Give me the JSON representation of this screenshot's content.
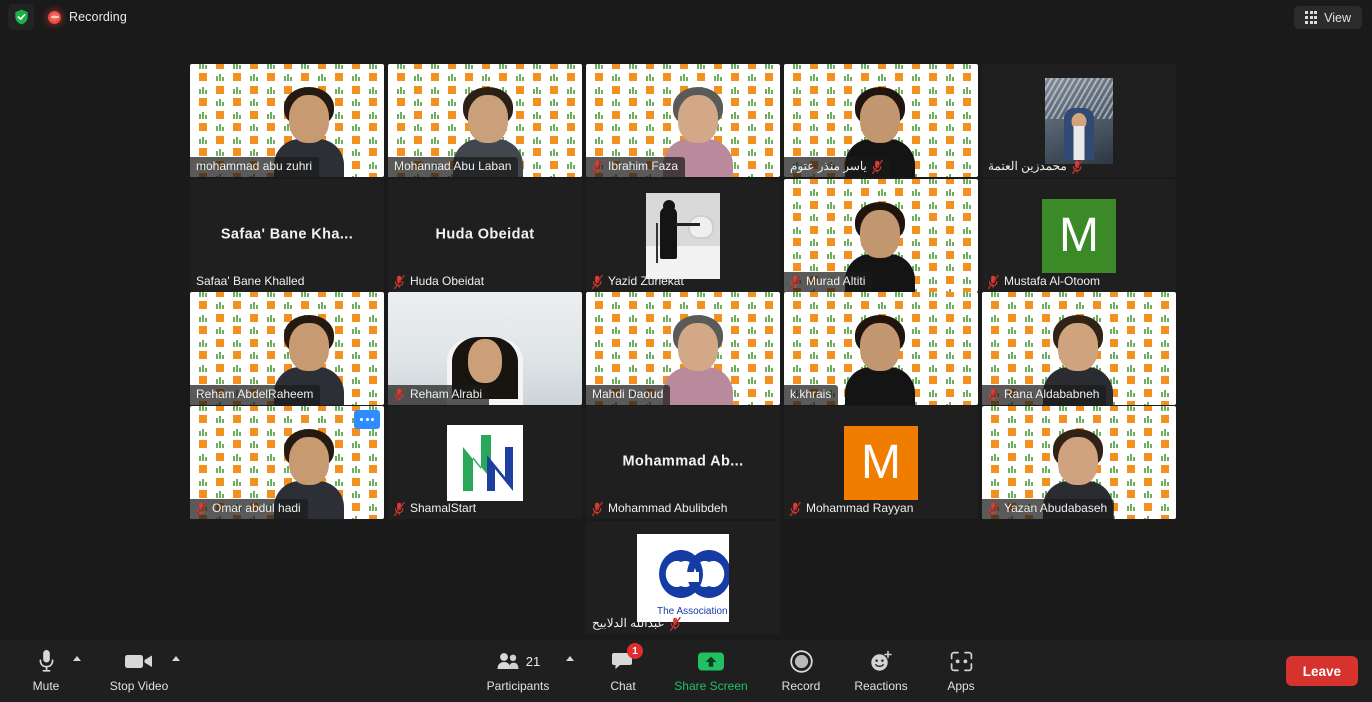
{
  "topbar": {
    "shield_icon": "security-shield-icon",
    "recording_icon": "recording-indicator-icon",
    "recording_label": "Recording",
    "view_icon": "grid-view-icon",
    "view_label": "View"
  },
  "gallery": {
    "active_speaker_color": "#d9ec4e",
    "rows": [
      {
        "tiles": [
          {
            "name": "mohammad abu zuhri",
            "display": "video",
            "muted": false,
            "rtl": false
          },
          {
            "name": "Mohannad Abu Laban",
            "display": "video",
            "muted": false,
            "rtl": false,
            "active": true
          },
          {
            "name": "Ibrahim Faza",
            "display": "video",
            "muted": true,
            "rtl": false
          },
          {
            "name": "ياسر منذر عتوم",
            "display": "video",
            "muted": true,
            "rtl": true
          },
          {
            "name": "محمدزين العتمة",
            "display": "photo",
            "muted": true,
            "rtl": true
          }
        ]
      },
      {
        "tiles": [
          {
            "name": "Safaa' Bane Khalled",
            "big_name": "Safaa' Bane Kha...",
            "display": "name-only",
            "muted": false,
            "rtl": false
          },
          {
            "name": "Huda Obeidat",
            "big_name": "Huda Obeidat",
            "display": "name-only",
            "muted": true,
            "rtl": false
          },
          {
            "name": "Yazid Zuriekat",
            "display": "photo-bw",
            "muted": true,
            "rtl": false
          },
          {
            "name": "Murad Altiti",
            "display": "video",
            "muted": true,
            "rtl": false
          },
          {
            "name": "Mustafa Al-Otoom",
            "display": "letter",
            "letter": "M",
            "letter_color": "#3c8a27",
            "muted": true,
            "rtl": false
          }
        ]
      },
      {
        "tiles": [
          {
            "name": "Reham AbdelRaheem",
            "display": "video",
            "muted": false,
            "rtl": false
          },
          {
            "name": "Reham Alrabi",
            "display": "video-plain",
            "muted": true,
            "rtl": false
          },
          {
            "name": "Mahdi Daoud",
            "display": "video",
            "muted": false,
            "rtl": false
          },
          {
            "name": "k.khrais",
            "display": "video",
            "muted": false,
            "rtl": false
          },
          {
            "name": "Rana Aldababneh",
            "display": "video",
            "muted": true,
            "rtl": false
          }
        ]
      },
      {
        "tiles": [
          {
            "name": "Omar abdul hadi",
            "display": "video",
            "muted": true,
            "rtl": false,
            "more_menu": "more-options-icon"
          },
          {
            "name": "ShamalStart",
            "display": "logo-n",
            "muted": true,
            "rtl": false
          },
          {
            "name": "Mohammad Abulibdeh",
            "big_name": "Mohammad  Ab...",
            "display": "name-only",
            "muted": true,
            "rtl": false
          },
          {
            "name": "Mohammad Rayyan",
            "display": "letter",
            "letter": "M",
            "letter_color": "#f07c00",
            "muted": true,
            "rtl": false
          },
          {
            "name": "Yazan Abudabaseh",
            "display": "video",
            "muted": true,
            "rtl": false
          }
        ]
      },
      {
        "tiles": [
          {
            "name": "عبدالله الدلابيح",
            "display": "logo-assoc",
            "logo_text": "The Association",
            "muted": true,
            "rtl": true
          }
        ]
      }
    ]
  },
  "toolbar": {
    "mute": {
      "label": "Mute",
      "icon": "microphone-icon",
      "chevron": "chevron-up-icon"
    },
    "video": {
      "label": "Stop Video",
      "icon": "camera-icon",
      "chevron": "chevron-up-icon"
    },
    "participants": {
      "label": "Participants",
      "icon": "participants-icon",
      "count": "21",
      "chevron": "chevron-up-icon"
    },
    "chat": {
      "label": "Chat",
      "icon": "chat-bubble-icon",
      "badge": "1"
    },
    "share": {
      "label": "Share Screen",
      "icon": "share-screen-icon",
      "color": "#21c063"
    },
    "record": {
      "label": "Record",
      "icon": "record-circle-icon"
    },
    "reactions": {
      "label": "Reactions",
      "icon": "reactions-smiley-icon"
    },
    "apps": {
      "label": "Apps",
      "icon": "apps-icon"
    },
    "leave": {
      "label": "Leave",
      "color": "#d6322e"
    }
  }
}
